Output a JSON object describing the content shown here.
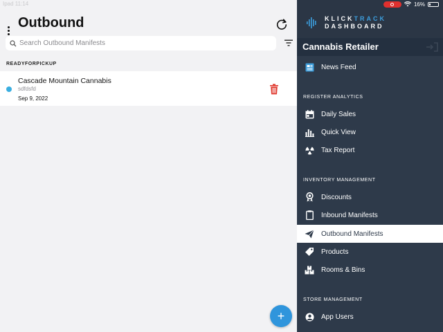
{
  "status": {
    "left_text": "Ipad 11:14",
    "battery": "16%"
  },
  "header": {
    "title": "Outbound"
  },
  "search": {
    "placeholder": "Search Outbound Manifests"
  },
  "sections": [
    {
      "label": "READYFORPICKUP",
      "items": [
        {
          "title": "Cascade Mountain Cannabis",
          "subtitle": "sdfdsfd",
          "date": "Sep 9, 2022",
          "status_color": "#3aaee0"
        }
      ]
    }
  ],
  "fab": {
    "label": "+"
  },
  "sidebar": {
    "brand_part1": "KLICK",
    "brand_part2": "TRACK",
    "brand_line2": "DASHBOARD",
    "store_name": "Cannabis Retailer",
    "items": [
      {
        "label": "News Feed",
        "icon": "newspaper-icon"
      },
      {
        "label": "Daily Sales",
        "icon": "calendar-icon"
      },
      {
        "label": "Quick View",
        "icon": "bar-chart-icon"
      },
      {
        "label": "Tax Report",
        "icon": "radiation-icon"
      },
      {
        "label": "Discounts",
        "icon": "award-icon"
      },
      {
        "label": "Inbound Manifests",
        "icon": "clipboard-icon"
      },
      {
        "label": "Outbound Manifests",
        "icon": "paper-plane-icon",
        "active": true
      },
      {
        "label": "Products",
        "icon": "tag-icon"
      },
      {
        "label": "Rooms & Bins",
        "icon": "boxes-icon"
      },
      {
        "label": "App Users",
        "icon": "user-circle-icon"
      }
    ],
    "section_register": "REGISTER ANALYTICS",
    "section_inventory": "INVENTORY MANAGEMENT",
    "section_store": "STORE MANAGEMENT"
  },
  "colors": {
    "accent": "#2f95dc",
    "sidebar_bg": "#2e3a4a",
    "delete": "#e03a2f"
  }
}
